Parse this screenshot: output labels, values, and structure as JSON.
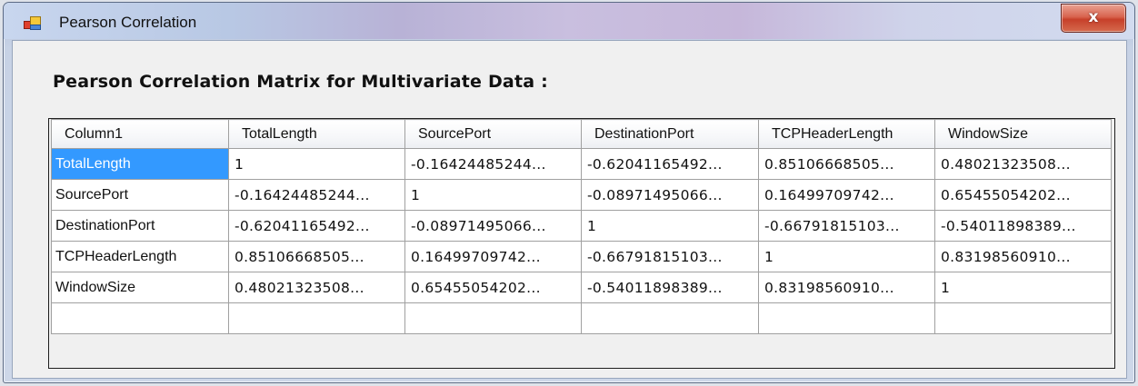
{
  "window": {
    "title": "Pearson Correlation",
    "close_label": "x"
  },
  "heading": "Pearson Correlation Matrix for Multivariate Data :",
  "grid": {
    "columns": [
      "Column1",
      "TotalLength",
      "SourcePort",
      "DestinationPort",
      "TCPHeaderLength",
      "WindowSize"
    ],
    "selected_row": 0,
    "rows": [
      [
        "TotalLength",
        "1",
        "-0.16424485244...",
        "-0.62041165492...",
        "0.85106668505...",
        "0.48021323508..."
      ],
      [
        "SourcePort",
        "-0.16424485244...",
        "1",
        "-0.08971495066...",
        "0.16499709742...",
        "0.65455054202..."
      ],
      [
        "DestinationPort",
        "-0.62041165492...",
        "-0.08971495066...",
        "1",
        "-0.66791815103...",
        "-0.54011898389..."
      ],
      [
        "TCPHeaderLength",
        "0.85106668505...",
        "0.16499709742...",
        "-0.66791815103...",
        "1",
        "0.83198560910..."
      ],
      [
        "WindowSize",
        "0.48021323508...",
        "0.65455054202...",
        "-0.54011898389...",
        "0.83198560910...",
        "1"
      ],
      [
        "",
        "",
        "",
        "",
        "",
        ""
      ]
    ]
  },
  "colors": {
    "selection": "#3399ff",
    "gridline": "#a0a0a0",
    "close_button": "#c7402a"
  },
  "icons": {
    "app": "application-icon",
    "close": "close-icon"
  }
}
